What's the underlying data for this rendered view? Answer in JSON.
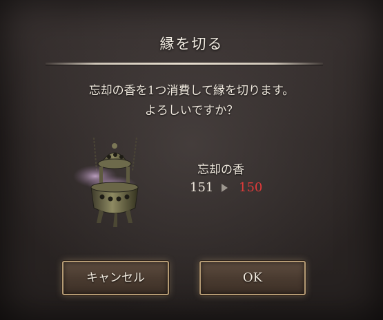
{
  "dialog": {
    "title": "縁を切る",
    "message_line1": "忘却の香を1つ消費して縁を切ります。",
    "message_line2": "よろしいですか？"
  },
  "item": {
    "name": "忘却の香",
    "icon": "incense-burner-icon",
    "count_before": "151",
    "count_after": "150"
  },
  "buttons": {
    "cancel_label": "キャンセル",
    "ok_label": "OK"
  },
  "colors": {
    "count_after": "#e23a3a",
    "button_border": "#b59b74"
  }
}
